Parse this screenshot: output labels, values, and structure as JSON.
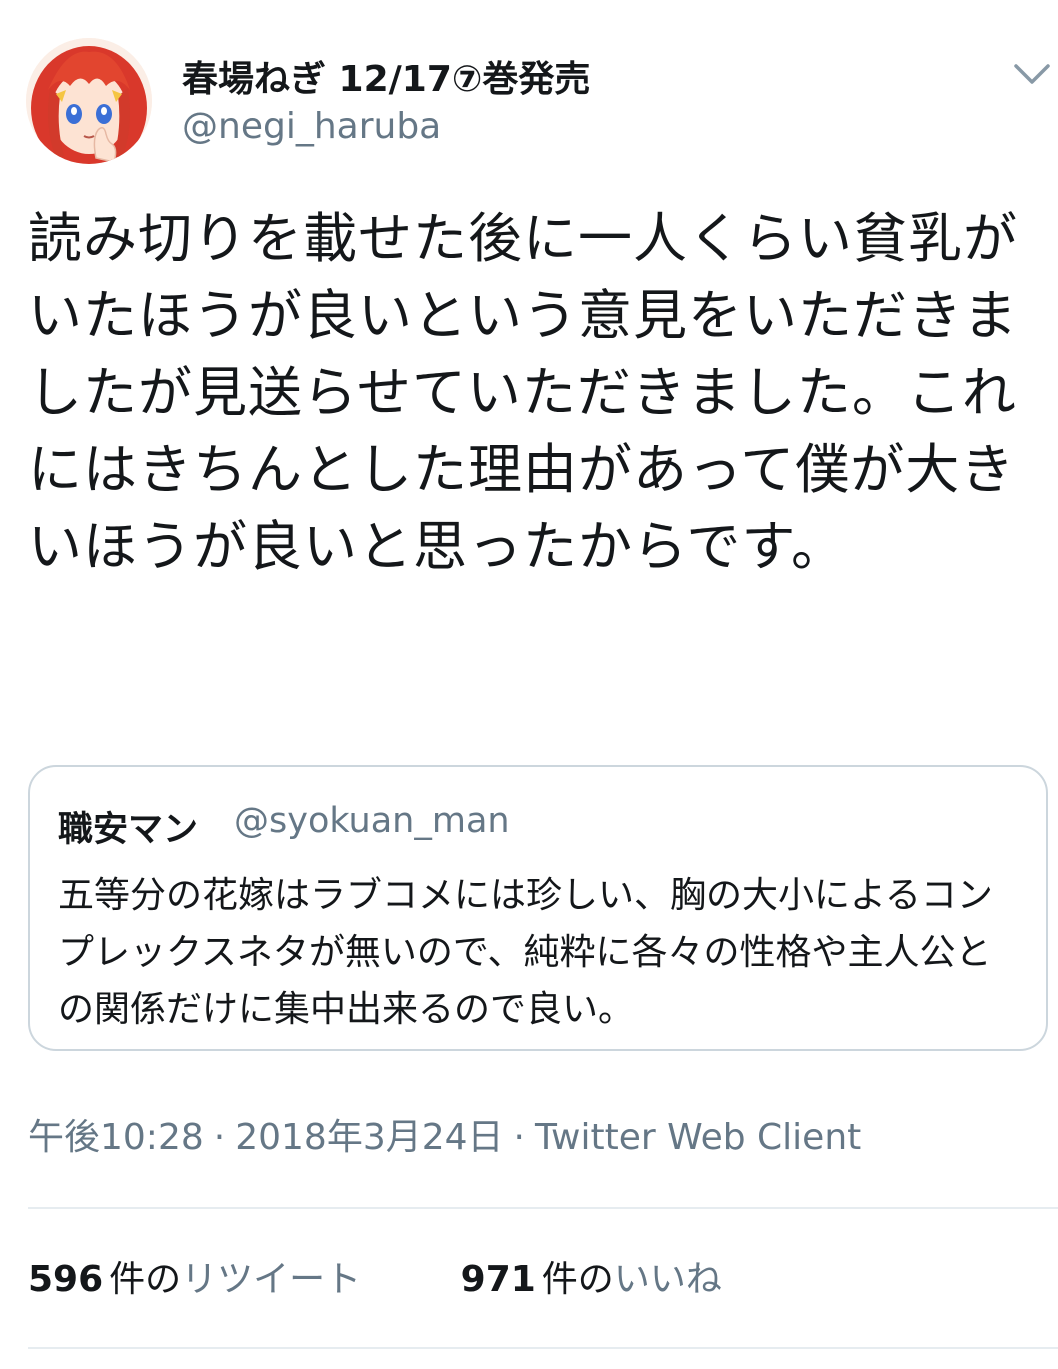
{
  "author": {
    "display_name": "春場ねぎ 12/17⑦巻発売",
    "handle": "@negi_haruba",
    "avatar_icon": "user-avatar-icon"
  },
  "tweet": {
    "text": "読み切りを載せた後に一人くらい貧乳がいたほうが良いという意見をいただきましたが見送らせていただきました。これにはきちんとした理由があって僕が大きいほうが良いと思ったからです。"
  },
  "quoted_tweet": {
    "display_name": "職安マン",
    "handle": "@syokuan_man",
    "text": "五等分の花嫁はラブコメには珍しい、胸の大小によるコンプレックスネタが無いので、純粋に各々の性格や主人公との関係だけに集中出来るので良い。"
  },
  "meta": {
    "time": "午後10:28",
    "separator": "·",
    "date": "2018年3月24日",
    "client": "Twitter Web Client"
  },
  "stats": {
    "retweets": {
      "count": "596",
      "unit": "件の",
      "label": "リツイート"
    },
    "likes": {
      "count": "971",
      "unit": "件の",
      "label": "いいね"
    }
  },
  "colors": {
    "text": "#14171a",
    "secondary": "#657786",
    "border": "#ccd6dd",
    "divider": "#e6ecf0"
  }
}
